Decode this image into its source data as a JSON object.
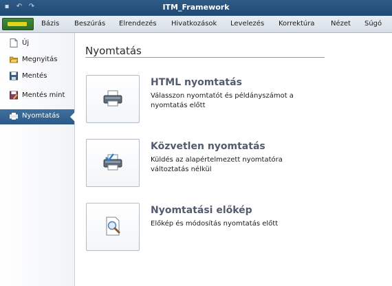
{
  "window": {
    "title": "ITM_Framework"
  },
  "ribbon": {
    "tabs": [
      "Bázis",
      "Beszúrás",
      "Elrendezés",
      "Hivatkozások",
      "Levelezés",
      "Korrektúra",
      "Nézet",
      "Súgó"
    ]
  },
  "sidebar": {
    "items": [
      {
        "label": "Új",
        "icon": "new-document-icon"
      },
      {
        "label": "Megnyitás",
        "icon": "folder-open-icon"
      },
      {
        "label": "Mentés",
        "icon": "save-icon"
      },
      {
        "label": "Mentés mint",
        "icon": "save-as-icon"
      },
      {
        "label": "Nyomtatás",
        "icon": "printer-icon",
        "active": true
      }
    ]
  },
  "main": {
    "title": "Nyomtatás",
    "options": [
      {
        "title": "HTML nyomtatás",
        "desc": "Válasszon nyomtatót és példányszámot a nyomtatás előtt",
        "icon": "printer-icon"
      },
      {
        "title": "Közvetlen nyomtatás",
        "desc": "Küldés az alapértelmezett nyomtatóra változtatás nélkül",
        "icon": "printer-check-icon"
      },
      {
        "title": "Nyomtatási előkép",
        "desc": "Előkép és módosítás nyomtatás előtt",
        "icon": "print-preview-icon"
      }
    ]
  },
  "colors": {
    "titlebar": "#24507c",
    "active_item": "#35638f",
    "file_tab": "#3a8a36",
    "option_title": "#535b6e"
  }
}
